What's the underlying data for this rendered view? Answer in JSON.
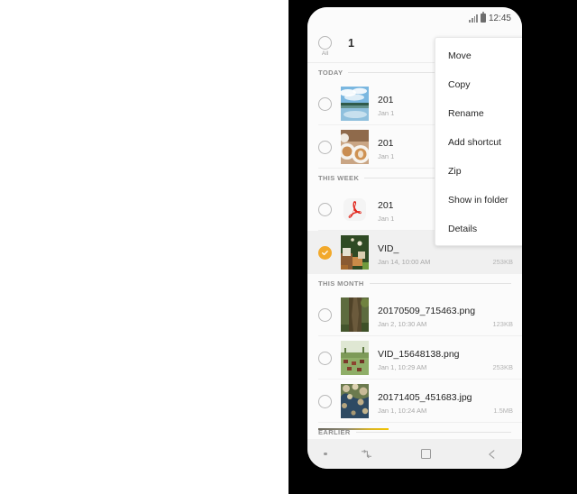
{
  "status_bar": {
    "time": "12:45",
    "signal_icon": "signal-bars-icon",
    "battery_icon": "battery-icon"
  },
  "header": {
    "all_checkbox_label": "All",
    "selected_count": "1"
  },
  "context_menu": {
    "items": [
      {
        "label": "Move"
      },
      {
        "label": "Copy"
      },
      {
        "label": "Rename"
      },
      {
        "label": "Add shortcut"
      },
      {
        "label": "Zip"
      },
      {
        "label": "Show in folder"
      },
      {
        "label": "Details"
      }
    ]
  },
  "sections": [
    {
      "title": "TODAY",
      "files": [
        {
          "name": "201",
          "date": "Jan 1",
          "size": "",
          "thumb": "lake-landscape-thumbnail",
          "selected": false,
          "obscured": true
        },
        {
          "name": "201",
          "date": "Jan 1",
          "size": "",
          "thumb": "coffee-cups-thumbnail",
          "selected": false,
          "obscured": true
        }
      ]
    },
    {
      "title": "THIS WEEK",
      "files": [
        {
          "name": "201",
          "date": "Jan 1",
          "size": "",
          "thumb": "pdf-file-icon",
          "selected": false,
          "obscured": true
        },
        {
          "name": "VID_",
          "date": "Jan 14, 10:00 AM",
          "size": "253KB",
          "thumb": "green-boxes-thumbnail",
          "selected": true,
          "obscured": true
        }
      ]
    },
    {
      "title": "THIS MONTH",
      "files": [
        {
          "name": "20170509_715463.png",
          "date": "Jan 2, 10:30 AM",
          "size": "123KB",
          "thumb": "tree-trunk-thumbnail",
          "selected": false,
          "obscured": false
        },
        {
          "name": "VID_15648138.png",
          "date": "Jan 1, 10:29 AM",
          "size": "253KB",
          "thumb": "field-cattle-thumbnail",
          "selected": false,
          "obscured": false
        },
        {
          "name": "20171405_451683.jpg",
          "date": "Jan 1, 10:24 AM",
          "size": "1.5MB",
          "thumb": "blossom-water-thumbnail",
          "selected": false,
          "obscured": false
        }
      ]
    },
    {
      "title": "EARLIER",
      "files": []
    }
  ],
  "nav_bar": {
    "dot_icon": "dot-indicator-icon",
    "recents_icon": "recents-switch-icon",
    "home_icon": "home-square-icon",
    "back_icon": "back-arrow-icon"
  },
  "colors": {
    "accent": "#f2a92b",
    "scroll_indicator": "#f3c400",
    "selected_row_bg": "#f0f0f0",
    "screen_bg": "#fbfbfb",
    "frame": "#000000"
  }
}
